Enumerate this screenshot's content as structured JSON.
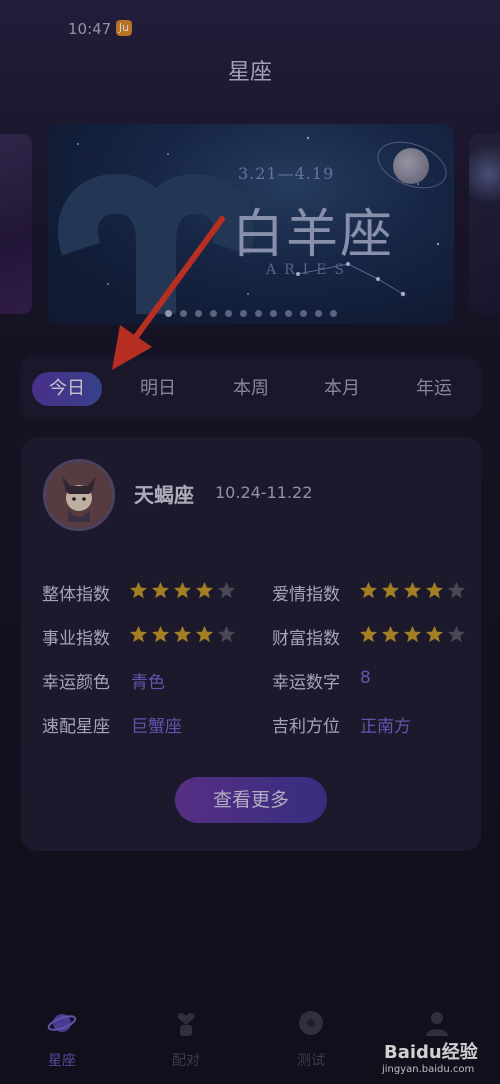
{
  "status_bar": {
    "time": "10:47",
    "app_badge": "Ju"
  },
  "header": {
    "title": "星座"
  },
  "banner": {
    "dates": "3.21—4.19",
    "name": "白羊座",
    "english": "ARIES",
    "dot_count": 12,
    "active_dot": 0
  },
  "tabs": [
    {
      "label": "今日",
      "active": true
    },
    {
      "label": "明日",
      "active": false
    },
    {
      "label": "本周",
      "active": false
    },
    {
      "label": "本月",
      "active": false
    },
    {
      "label": "年运",
      "active": false
    }
  ],
  "sign": {
    "name": "天蝎座",
    "dates": "10.24-11.22"
  },
  "ratings": {
    "overall": {
      "label": "整体指数",
      "stars": 4,
      "max": 5
    },
    "love": {
      "label": "爱情指数",
      "stars": 4,
      "max": 5
    },
    "career": {
      "label": "事业指数",
      "stars": 4,
      "max": 5
    },
    "wealth": {
      "label": "财富指数",
      "stars": 4,
      "max": 5
    }
  },
  "details": {
    "lucky_color": {
      "label": "幸运颜色",
      "value": "青色"
    },
    "lucky_number": {
      "label": "幸运数字",
      "value": "8"
    },
    "match_sign": {
      "label": "速配星座",
      "value": "巨蟹座"
    },
    "lucky_direction": {
      "label": "吉利方位",
      "value": "正南方"
    }
  },
  "more_button": "查看更多",
  "bottom_nav": [
    {
      "label": "星座",
      "icon": "planet-icon",
      "active": true
    },
    {
      "label": "配对",
      "icon": "heart-hand-icon",
      "active": false
    },
    {
      "label": "测试",
      "icon": "crystal-ball-icon",
      "active": false
    },
    {
      "label": "",
      "icon": "profile-icon",
      "active": false
    }
  ],
  "watermark": {
    "text": "Baidu经验",
    "url": "jingyan.baidu.com"
  },
  "colors": {
    "accent": "#5a3aa8",
    "star_filled": "#c79a2a",
    "star_empty": "#5c5868",
    "value_text": "#7b66d4"
  }
}
